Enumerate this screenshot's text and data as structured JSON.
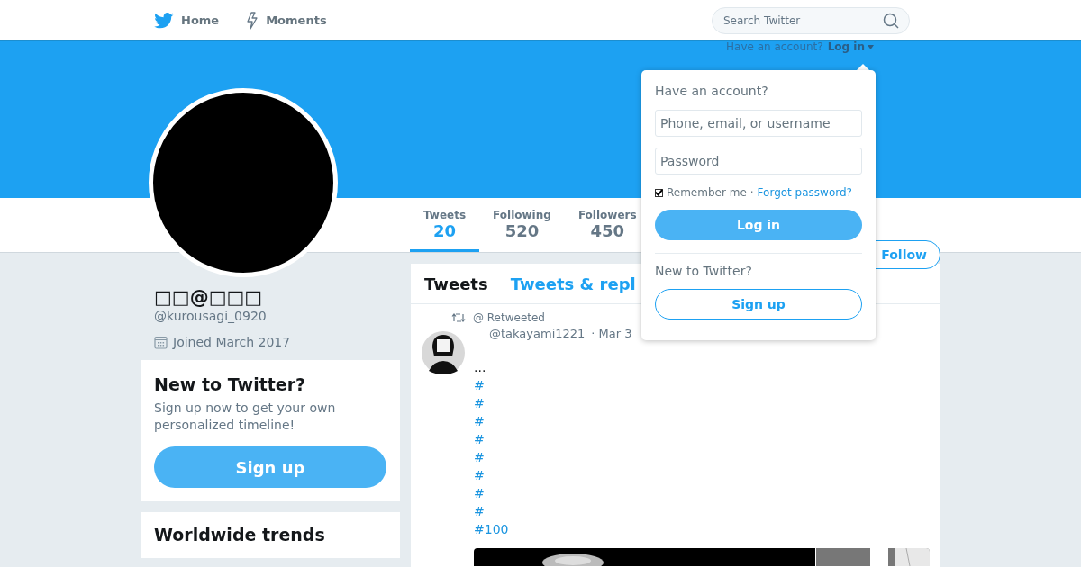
{
  "nav": {
    "items": [
      {
        "kind": "home",
        "label": "Home"
      },
      {
        "kind": "moments",
        "label": "Moments"
      }
    ]
  },
  "search": {
    "placeholder": "Search Twitter"
  },
  "login_prompt": {
    "text": "Have an account?",
    "link": "Log in"
  },
  "stats": [
    {
      "label": "Tweets",
      "value": "20",
      "selected": true
    },
    {
      "label": "Following",
      "value": "520",
      "selected": false
    },
    {
      "label": "Followers",
      "value": "450",
      "selected": false
    }
  ],
  "follow_button": "Follow",
  "profile": {
    "name": "□□@□□□",
    "handle": "@kurousagi_0920",
    "joined": "Joined March 2017"
  },
  "signup_card": {
    "title": "New to Twitter?",
    "text": "Sign up now to get your own personalized timeline!",
    "button": "Sign up"
  },
  "trends": {
    "title": "Worldwide trends"
  },
  "timeline_tabs": [
    {
      "label": "Tweets",
      "selected": true
    },
    {
      "label": "Tweets & repl",
      "selected": false
    }
  ],
  "tweet": {
    "retweet_label": "@ Retweeted",
    "handle": "@takayami1221",
    "time": "· Mar 3",
    "text": "...",
    "hashtags": [
      "#",
      "#",
      "#",
      "#",
      "#",
      "#",
      "#",
      "#",
      "#100"
    ]
  },
  "dropdown": {
    "title": "Have an account?",
    "fields": [
      {
        "placeholder": "Phone, email, or username"
      },
      {
        "placeholder": "Password"
      }
    ],
    "remember": {
      "label": "Remember me",
      "checked": true,
      "separator": "·"
    },
    "forgot": "Forgot password?",
    "login_button": "Log in",
    "signup_title": "New to Twitter?",
    "signup_button": "Sign up"
  }
}
